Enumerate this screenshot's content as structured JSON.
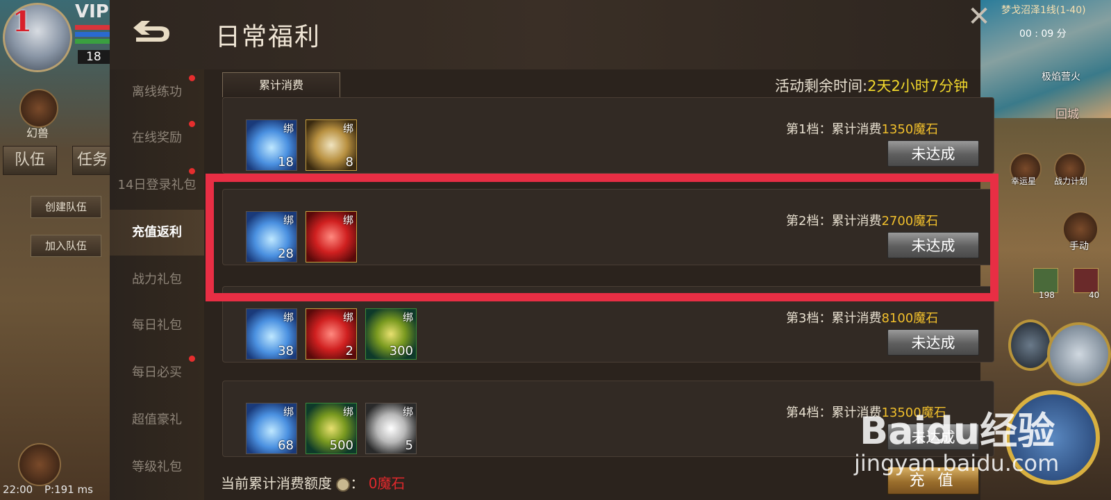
{
  "hud": {
    "level": "1",
    "vip": "VIP",
    "player_level": "18",
    "pet_label": "幻兽",
    "tabs": [
      "队伍",
      "任务"
    ],
    "create_team": "创建队伍",
    "join_team": "加入队伍",
    "time": "22:00",
    "ping": "P:191 ms",
    "map_name": "梦戈沼泽1线(1-40)",
    "map_time": "00 : 09 分",
    "map_place": "极焰营火",
    "return_city": "回城",
    "lucky_star": "幸运星",
    "battle_plan": "战力计划",
    "manual": "手动",
    "slot_counts": [
      "198",
      "40"
    ]
  },
  "panel": {
    "title": "日常福利",
    "close_icon": "close-icon",
    "back_icon": "back-arrow-icon"
  },
  "sidebar": {
    "items": [
      {
        "label": "离线练功",
        "dot": true
      },
      {
        "label": "在线奖励",
        "dot": true
      },
      {
        "label": "14日登录礼包",
        "dot": true
      },
      {
        "label": "充值返利",
        "dot": false,
        "active": true
      },
      {
        "label": "战力礼包",
        "dot": false
      },
      {
        "label": "每日礼包",
        "dot": false
      },
      {
        "label": "每日必买",
        "dot": true
      },
      {
        "label": "超值豪礼",
        "dot": false
      },
      {
        "label": "等级礼包",
        "dot": false
      }
    ]
  },
  "content": {
    "tab": "累计消费",
    "remaining_label": "活动剩余时间:",
    "remaining_value": "2天2小时7分钟",
    "tiers": [
      {
        "label": "第1档：累计消费",
        "amount": "1350魔石",
        "button": "未达成",
        "items": [
          {
            "icon": "blue-crystal-icon",
            "count": "18",
            "bind": "绑"
          },
          {
            "icon": "gold-shield-icon",
            "count": "8",
            "bind": "绑"
          }
        ]
      },
      {
        "label": "第2档：累计消费",
        "amount": "2700魔石",
        "button": "未达成",
        "items": [
          {
            "icon": "blue-crystal-icon",
            "count": "28",
            "bind": "绑"
          },
          {
            "icon": "red-gem-icon",
            "count": "",
            "bind": "绑"
          }
        ]
      },
      {
        "label": "第3档：累计消费",
        "amount": "8100魔石",
        "button": "未达成",
        "items": [
          {
            "icon": "blue-crystal-icon",
            "count": "38",
            "bind": "绑"
          },
          {
            "icon": "red-gem-icon",
            "count": "2",
            "bind": "绑"
          },
          {
            "icon": "green-coin-icon",
            "count": "300",
            "bind": "绑"
          }
        ]
      },
      {
        "label": "第4档：累计消费",
        "amount": "13500魔石",
        "button": "未达成",
        "items": [
          {
            "icon": "blue-crystal-icon",
            "count": "68",
            "bind": "绑"
          },
          {
            "icon": "green-coin-icon",
            "count": "500",
            "bind": "绑"
          },
          {
            "icon": "silver-ore-icon",
            "count": "5",
            "bind": "绑"
          }
        ]
      }
    ],
    "current_label": "当前累计消费额度",
    "current_value": "0魔石",
    "recharge_button": "充 值"
  },
  "watermark": {
    "brand": "Baidu经验",
    "url": "jingyan.baidu.com"
  },
  "colors": {
    "highlight": "#e82e44",
    "amount": "#f2c02c",
    "remaining": "#f2d82c",
    "red_dot": "#e62e2e"
  }
}
